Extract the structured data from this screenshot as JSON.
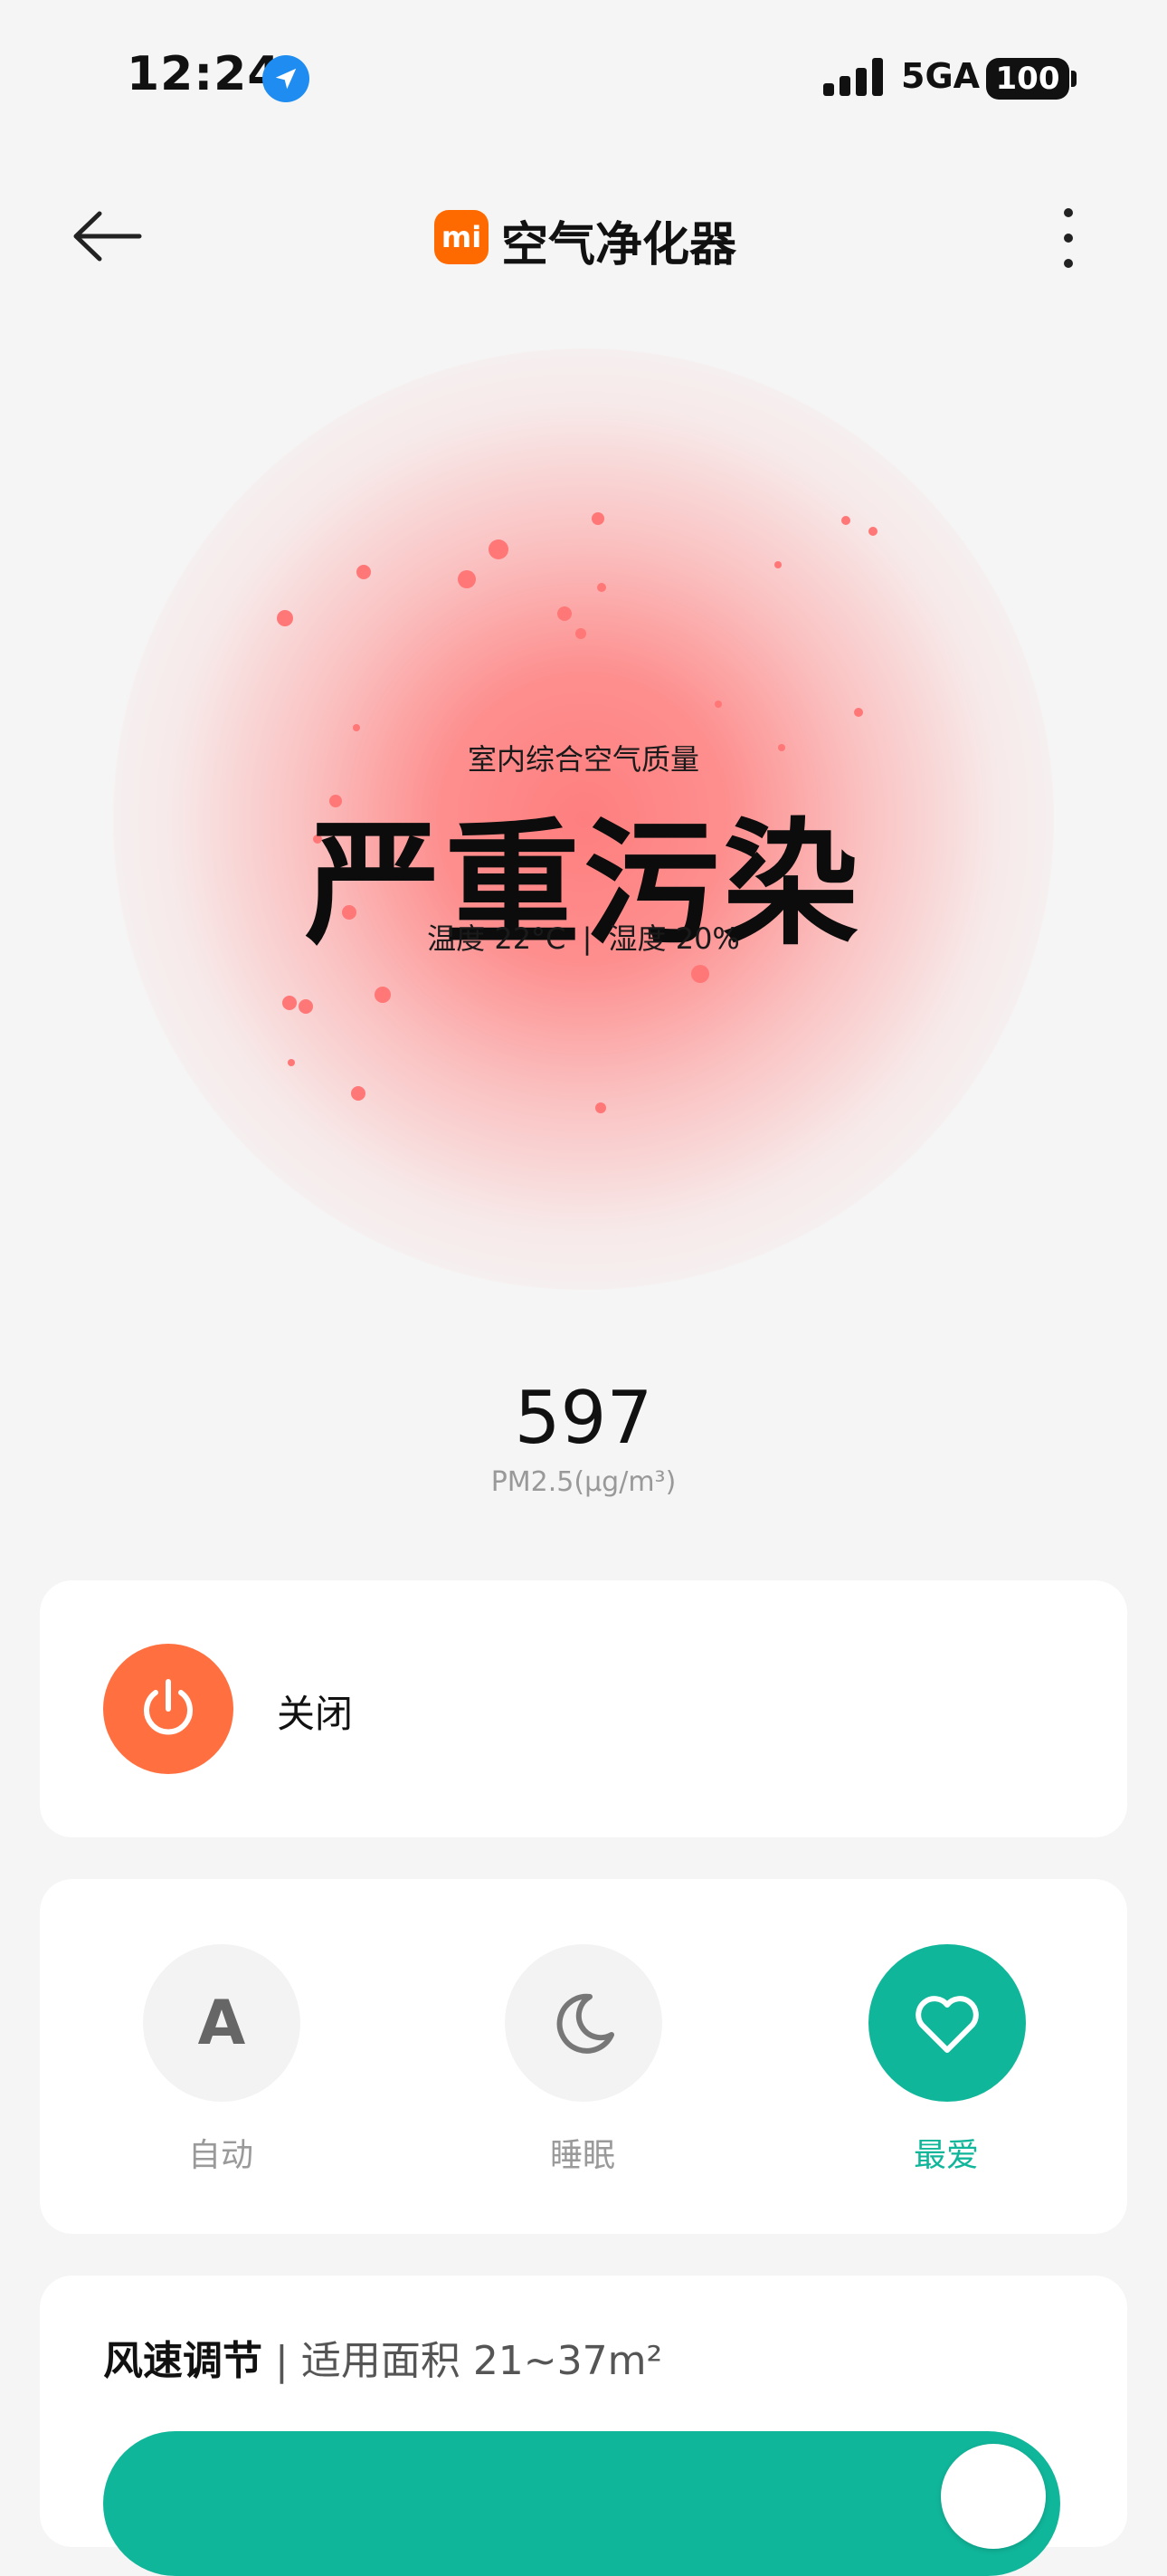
{
  "status_bar": {
    "time": "12:24",
    "network": "5GA",
    "battery": "100"
  },
  "header": {
    "brand_logo": "mi",
    "title": "空气净化器"
  },
  "air_quality": {
    "label": "室内综合空气质量",
    "status": "严重污染",
    "temperature": "温度 22°C",
    "separator": "|",
    "humidity": "湿度 20%",
    "glow_color": "#ff7a7a"
  },
  "pm25": {
    "value": "597",
    "unit": "PM2.5(µg/m³)"
  },
  "power": {
    "label": "关闭",
    "button_color": "#ff6f3f"
  },
  "modes": {
    "items": [
      {
        "label": "自动",
        "icon": "auto-letter-icon",
        "glyph": "A",
        "active": false
      },
      {
        "label": "睡眠",
        "icon": "moon-icon",
        "active": false
      },
      {
        "label": "最爱",
        "icon": "heart-icon",
        "active": true
      }
    ],
    "accent_color": "#10b69a"
  },
  "fan_speed": {
    "title": "风速调节",
    "separator": "|",
    "subtitle": "适用面积 21~37m²"
  }
}
